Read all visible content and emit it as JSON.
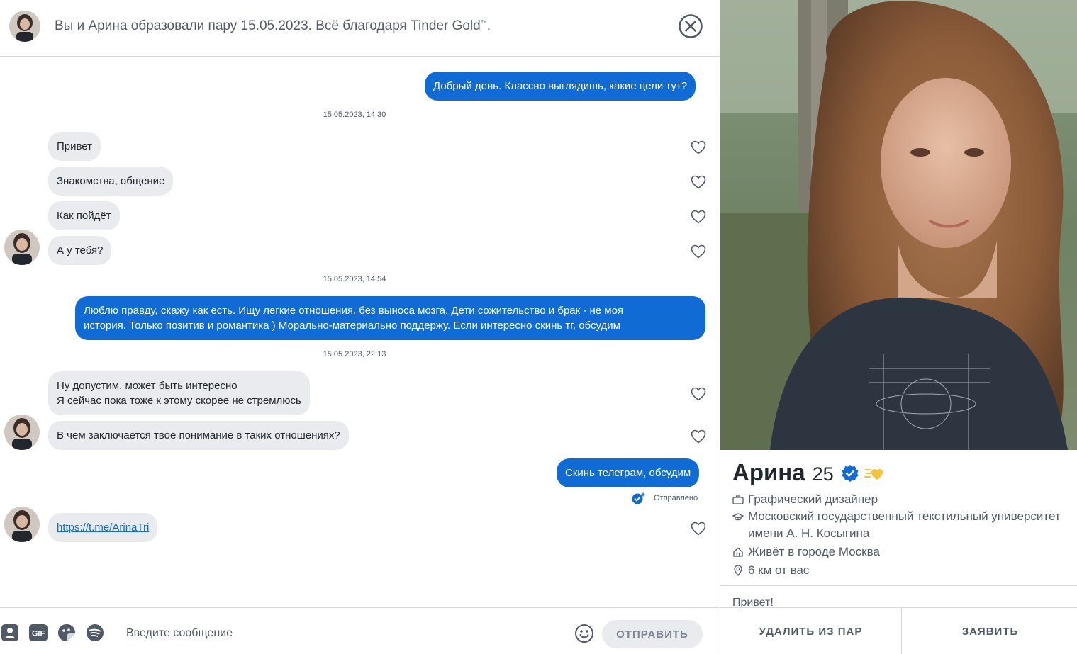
{
  "header": {
    "title_prefix": "Вы и Арина образовали пару 15.05.2023. Всё благодаря ",
    "title_brand": "Tinder Gold",
    "title_tm": "™",
    "title_suffix": ".",
    "close_icon": "close-circle-icon"
  },
  "messages": [
    {
      "dir": "out",
      "text": "Добрый день. Классно выглядишь, какие цели тут?"
    },
    {
      "timestamp": "15.05.2023, 14:30"
    },
    {
      "dir": "in",
      "text": "Привет"
    },
    {
      "dir": "in",
      "text": "Знакомства, общение"
    },
    {
      "dir": "in",
      "text": "Как пойдёт"
    },
    {
      "dir": "in",
      "text": "А у тебя?"
    },
    {
      "timestamp": "15.05.2023, 14:54"
    },
    {
      "dir": "out",
      "line1": "Люблю правду, скажу как есть. Ищу легкие отношения, без выноса мозга. Дети сожительство и брак - не моя",
      "line2": "история. Только позитив и романтика ) Морально-материально поддержу. Если интересно скинь тг, обсудим"
    },
    {
      "timestamp": "15.05.2023, 22:13"
    },
    {
      "dir": "in",
      "line1": "Ну допустим, может быть интересно",
      "line2": "Я сейчас пока тоже к этому скорее не стремлюсь"
    },
    {
      "dir": "in",
      "text": "В чем заключается твоё понимание в таких отношениях?"
    },
    {
      "dir": "out",
      "text": "Скинь телеграм, обсудим",
      "status": "Отправлено"
    },
    {
      "dir": "in",
      "link": "https://t.me/ArinaTri"
    }
  ],
  "composer": {
    "placeholder": "Введите сообщение",
    "send_label": "ОТПРАВИТЬ",
    "icons": [
      "contact-card-icon",
      "gif-icon",
      "sticker-icon",
      "spotify-icon",
      "emoji-icon"
    ],
    "gif_label": "GIF"
  },
  "profile": {
    "name": "Арина",
    "age": "25",
    "job": "Графический дизайнер",
    "school_line1": "Московский государственный текстильный университет",
    "school_line2": "имени А. Н. Косыгина",
    "lives": "Живёт в городе Москва",
    "distance": "6 км от вас",
    "bio": "Привет!",
    "unmatch_label": "УДАЛИТЬ ИЗ ПАР",
    "report_label": "ЗАЯВИТЬ"
  },
  "colors": {
    "accent_blue": "#106bd5",
    "bubble_gray": "#e9ebee",
    "text_dark": "#21262e",
    "text_muted": "#505965",
    "gold": "#f5c23b"
  }
}
